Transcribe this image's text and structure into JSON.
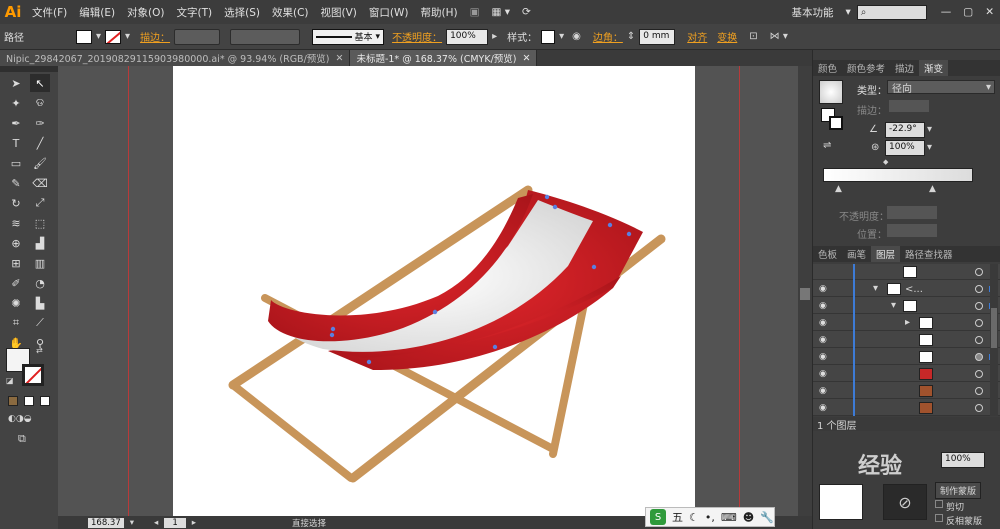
{
  "app": {
    "logo": "Ai",
    "workspace": "基本功能"
  },
  "menu": [
    "文件(F)",
    "编辑(E)",
    "对象(O)",
    "文字(T)",
    "选择(S)",
    "效果(C)",
    "视图(V)",
    "窗口(W)",
    "帮助(H)"
  ],
  "control": {
    "selection": "路径",
    "stroke_label": "描边：",
    "stroke_style": "基本",
    "opacity_label": "不透明度：",
    "opacity_value": "100%",
    "style_label": "样式：",
    "corner_label": "边角：",
    "corner_value": "0 mm",
    "align_label": "对齐",
    "transform_label": "变换"
  },
  "tabs": [
    {
      "label": "Nipic_29842067_20190829115903980000.ai* @ 93.94% (RGB/预览)",
      "active": false
    },
    {
      "label": "未标题-1* @ 168.37% (CMYK/预览)",
      "active": true
    }
  ],
  "gradient_panel": {
    "tabs": [
      "颜色",
      "颜色参考",
      "描边",
      "渐变"
    ],
    "type_label": "类型：",
    "type_value": "径向",
    "stroke_label": "描边：",
    "angle": "-22.9°",
    "ratio": "100%",
    "opacity_label": "不透明度：",
    "position_label": "位置："
  },
  "layers_panel": {
    "tabs": [
      "色板",
      "画笔",
      "图层",
      "路径查找器"
    ],
    "rows": [
      {
        "name": "",
        "indent": 0
      },
      {
        "name": "<...",
        "indent": 1
      },
      {
        "name": "",
        "indent": 2
      },
      {
        "name": "",
        "indent": 3
      },
      {
        "name": "",
        "indent": 3
      },
      {
        "name": "",
        "indent": 3
      },
      {
        "name": "",
        "indent": 3
      },
      {
        "name": "",
        "indent": 3
      },
      {
        "name": "",
        "indent": 3
      }
    ],
    "footer": "1 个图层"
  },
  "bottom_panel": {
    "opacity": "100%",
    "make_mask": "制作蒙版",
    "clip": "剪切",
    "invert": "反相蒙版"
  },
  "status": {
    "zoom": "168.37",
    "page": "1",
    "tool": "直接选择"
  },
  "ime": {
    "label": "五"
  },
  "watermark": "经验",
  "colors": {
    "stripe_red": "#e0262b",
    "stripe_white": "#f2f2f2",
    "wood": "#c8955a",
    "wood_dark": "#a87640",
    "guide": "#b83a3a",
    "accent": "#ff9a00"
  }
}
